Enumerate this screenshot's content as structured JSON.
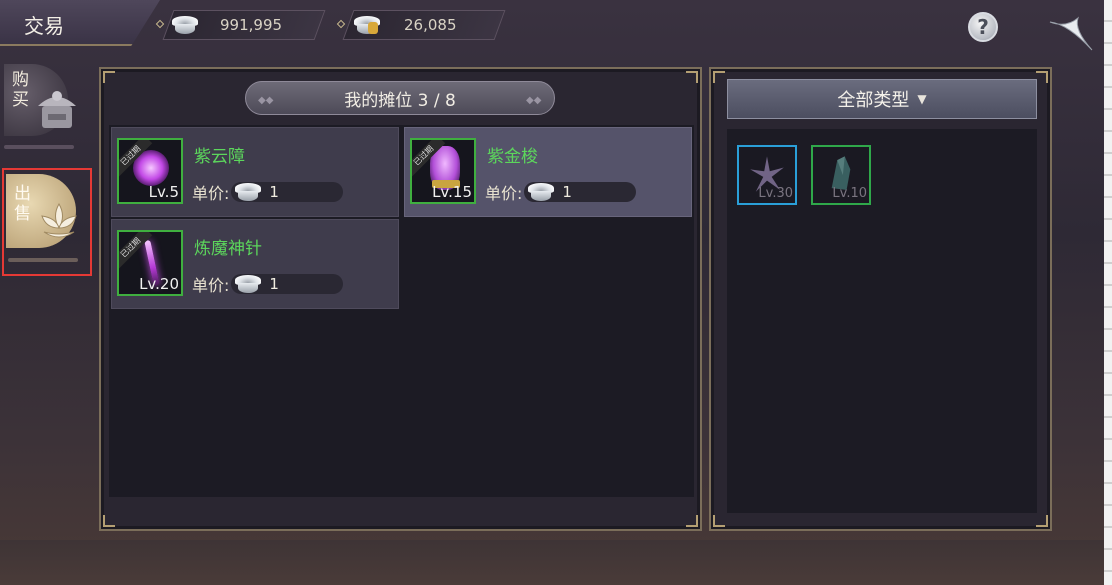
{
  "header": {
    "title": "交易",
    "silver_amount": "991,995",
    "bound_silver_amount": "26,085",
    "help_label": "?"
  },
  "side_tabs": [
    {
      "label": "购买",
      "active": false
    },
    {
      "label": "出售",
      "active": true
    }
  ],
  "stall": {
    "header": "我的摊位 3 / 8",
    "items": [
      {
        "name": "紫云障",
        "ribbon": "已过期",
        "level": "Lv.5",
        "price_label": "单价:",
        "price": "1",
        "icon": "purple-orb-icon",
        "selected": false
      },
      {
        "name": "紫金梭",
        "ribbon": "已过期",
        "level": "Lv.15",
        "price_label": "单价:",
        "price": "1",
        "icon": "purple-shuttle-icon",
        "selected": true
      },
      {
        "name": "炼魔神针",
        "ribbon": "已过期",
        "level": "Lv.20",
        "price_label": "单价:",
        "price": "1",
        "icon": "magic-needle-icon",
        "selected": false
      }
    ]
  },
  "inventory": {
    "filter_label": "全部类型",
    "items": [
      {
        "level": "Lv.30",
        "icon": "spiked-weapon-icon",
        "border_color": "#2a9fd8"
      },
      {
        "level": "Lv.10",
        "icon": "green-crystal-icon",
        "border_color": "#2fa84a"
      }
    ]
  },
  "colors": {
    "item_name": "#5cd65c",
    "selected_tab_border": "#e53935",
    "panel_border": "#7b6e5a"
  }
}
